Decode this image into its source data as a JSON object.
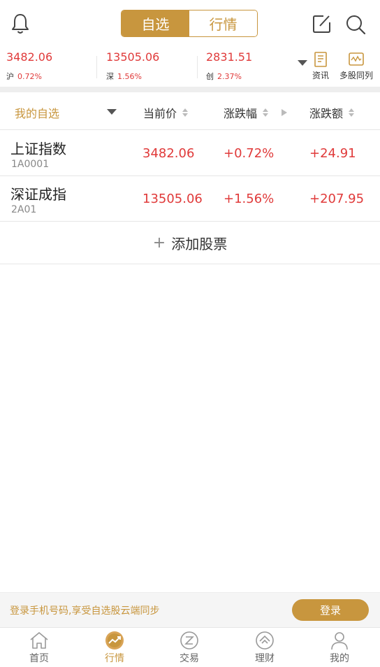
{
  "header": {
    "bell_icon": "bell-icon",
    "segments": [
      {
        "label": "自选",
        "active": true
      },
      {
        "label": "行情",
        "active": false
      }
    ],
    "edit_icon": "edit-icon",
    "search_icon": "search-icon"
  },
  "indices": [
    {
      "value": "3482.06",
      "market": "沪",
      "pct": "0.72%"
    },
    {
      "value": "13505.06",
      "market": "深",
      "pct": "1.56%"
    },
    {
      "value": "2831.51",
      "market": "创",
      "pct": "2.37%"
    }
  ],
  "tools": [
    {
      "label": "资讯",
      "icon": "news-icon"
    },
    {
      "label": "多股同列",
      "icon": "multi-chart-icon"
    }
  ],
  "table": {
    "columns": [
      "我的自选",
      "当前价",
      "涨跌幅",
      "涨跌额"
    ],
    "rows": [
      {
        "name": "上证指数",
        "code": "1A0001",
        "price": "3482.06",
        "pct": "+0.72%",
        "change": "+24.91"
      },
      {
        "name": "深证成指",
        "code": "2A01",
        "price": "13505.06",
        "pct": "+1.56%",
        "change": "+207.95"
      }
    ],
    "add_plus": "+",
    "add_label": "添加股票"
  },
  "login": {
    "tip": "登录手机号码,享受自选股云端同步",
    "button": "登录"
  },
  "tabbar": [
    {
      "label": "首页",
      "icon": "home-icon",
      "active": false
    },
    {
      "label": "行情",
      "icon": "market-icon",
      "active": true
    },
    {
      "label": "交易",
      "icon": "trade-icon",
      "active": false
    },
    {
      "label": "理财",
      "icon": "wealth-icon",
      "active": false
    },
    {
      "label": "我的",
      "icon": "profile-icon",
      "active": false
    }
  ],
  "colors": {
    "accent": "#c8963e",
    "up": "#e03a3a"
  }
}
